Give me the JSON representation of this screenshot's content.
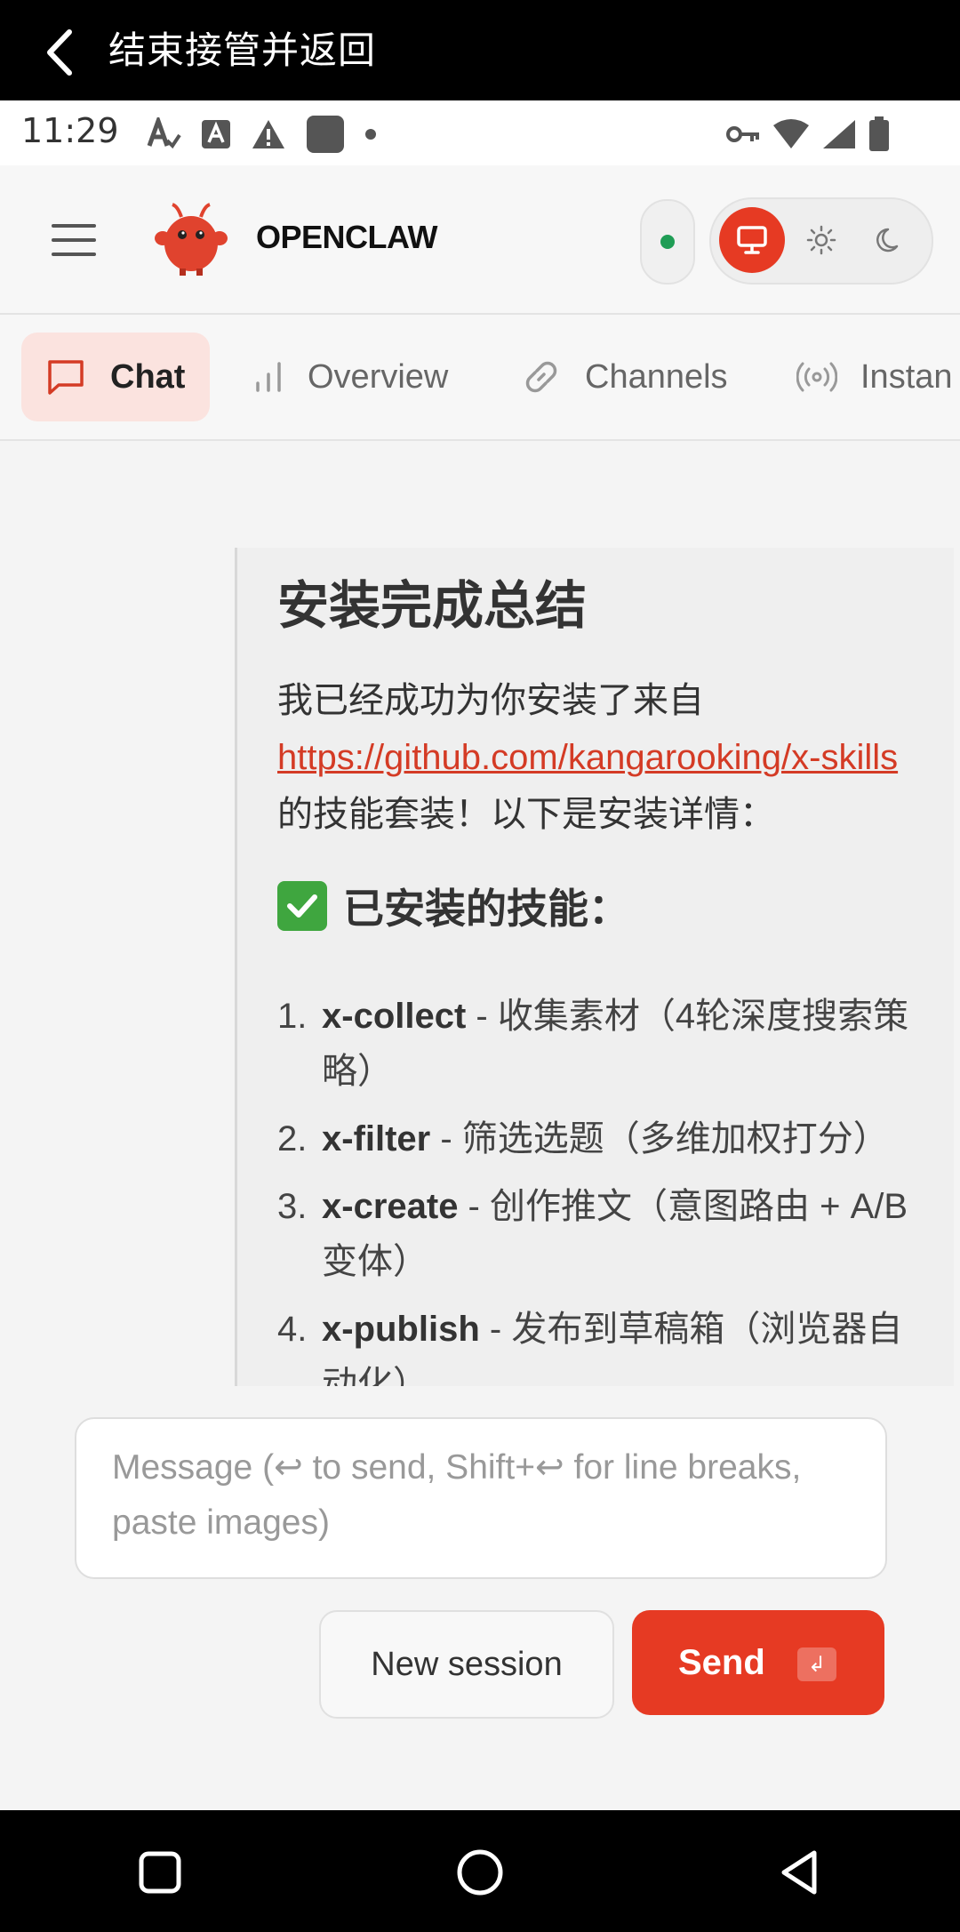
{
  "topbar": {
    "title": "结束接管并返回",
    "back_icon": "chevron-left-icon"
  },
  "statusbar": {
    "time": "11:29"
  },
  "header": {
    "brand": "OPENCLAW",
    "accent_color": "#e63a23",
    "connection_status_color": "#1f9d55",
    "theme_options": [
      "monitor-icon",
      "sun-icon",
      "moon-icon"
    ],
    "theme_selected": "monitor-icon"
  },
  "nav": {
    "tabs": [
      {
        "label": "Chat",
        "icon": "chat-bubble-icon",
        "active": true
      },
      {
        "label": "Overview",
        "icon": "bar-chart-icon",
        "active": false
      },
      {
        "label": "Channels",
        "icon": "link-icon",
        "active": false
      },
      {
        "label": "Instan",
        "icon": "broadcast-icon",
        "active": false
      }
    ]
  },
  "message": {
    "heading": "安装完成总结",
    "intro_before": "我已经成功为你安装了来自",
    "link": "https://github.com/kangarooking/x-skills",
    "intro_after": "的技能套装！以下是安装详情：",
    "subheading": "已安装的技能：",
    "skills": [
      {
        "num": "1.",
        "name": "x-collect",
        "desc": " - 收集素材（4轮深度搜索策略）"
      },
      {
        "num": "2.",
        "name": "x-filter",
        "desc": " - 筛选选题（多维加权打分）"
      },
      {
        "num": "3.",
        "name": "x-create",
        "desc": " - 创作推文（意图路由 + A/B变体）"
      },
      {
        "num": "4.",
        "name": "x-publish",
        "desc": " - 发布到草稿箱（浏览器自动化）"
      }
    ]
  },
  "composer": {
    "placeholder": "Message (↩ to send, Shift+↩ for line breaks, paste images)",
    "new_session_label": "New session",
    "send_label": "Send",
    "send_shortcut": "↲"
  }
}
